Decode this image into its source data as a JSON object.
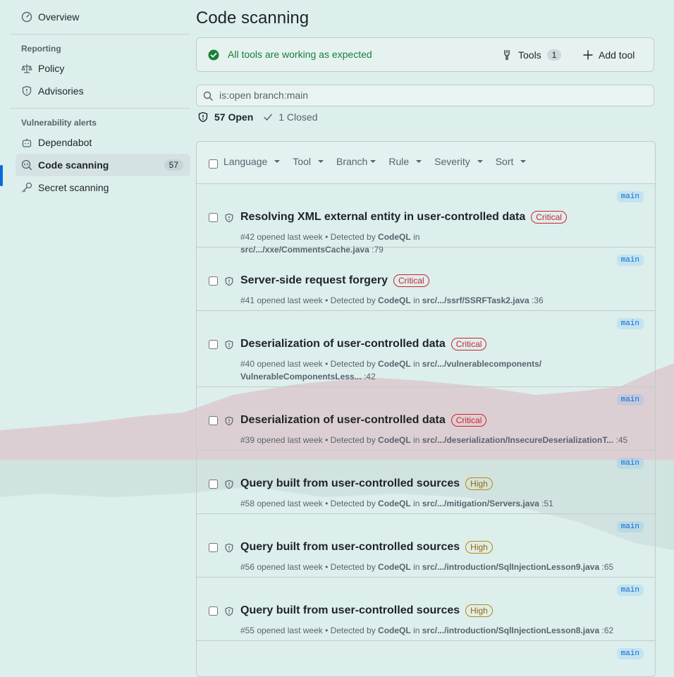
{
  "sidebar": {
    "overview": "Overview",
    "reporting_label": "Reporting",
    "policy": "Policy",
    "advisories": "Advisories",
    "vuln_label": "Vulnerability alerts",
    "dependabot": "Dependabot",
    "code_scanning": "Code scanning",
    "code_scanning_count": "57",
    "secret_scanning": "Secret scanning"
  },
  "main": {
    "title": "Code scanning",
    "status_text": "All tools are working as expected",
    "tools_label": "Tools",
    "tools_count": "1",
    "add_tool_label": "Add tool",
    "search_value": "is:open branch:main",
    "open_label": "57 Open",
    "closed_label": "1 Closed",
    "filters": [
      "Language",
      "Tool",
      "Branch",
      "Rule",
      "Severity",
      "Sort"
    ]
  },
  "alerts": [
    {
      "title": "Resolving XML external entity in user-controlled data",
      "severity": "Critical",
      "number": "#42",
      "opened": "opened last week",
      "detected": "Detected by",
      "tool": "CodeQL",
      "in": "in",
      "path": "src/.../xxe/CommentsCache.java",
      "line": ":79",
      "branch": "main"
    },
    {
      "title": "Server-side request forgery",
      "severity": "Critical",
      "number": "#41",
      "opened": "opened last week",
      "detected": "Detected by",
      "tool": "CodeQL",
      "in": "in",
      "path": "src/.../ssrf/SSRFTask2.java",
      "line": ":36",
      "branch": "main"
    },
    {
      "title": "Deserialization of user-controlled data",
      "severity": "Critical",
      "number": "#40",
      "opened": "opened last week",
      "detected": "Detected by",
      "tool": "CodeQL",
      "in": "in",
      "path": "src/.../vulnerablecomponents/ VulnerableComponentsLess...",
      "line": ":42",
      "branch": "main"
    },
    {
      "title": "Deserialization of user-controlled data",
      "severity": "Critical",
      "number": "#39",
      "opened": "opened last week",
      "detected": "Detected by",
      "tool": "CodeQL",
      "in": "in",
      "path": "src/.../deserialization/InsecureDeserializationT...",
      "line": ":45",
      "branch": "main"
    },
    {
      "title": "Query built from user-controlled sources",
      "severity": "High",
      "number": "#58",
      "opened": "opened last week",
      "detected": "Detected by",
      "tool": "CodeQL",
      "in": "in",
      "path": "src/.../mitigation/Servers.java",
      "line": ":51",
      "branch": "main"
    },
    {
      "title": "Query built from user-controlled sources",
      "severity": "High",
      "number": "#56",
      "opened": "opened last week",
      "detected": "Detected by",
      "tool": "CodeQL",
      "in": "in",
      "path": "src/.../introduction/SqlInjectionLesson9.java",
      "line": ":65",
      "branch": "main"
    },
    {
      "title": "Query built from user-controlled sources",
      "severity": "High",
      "number": "#55",
      "opened": "opened last week",
      "detected": "Detected by",
      "tool": "CodeQL",
      "in": "in",
      "path": "src/.../introduction/SqlInjectionLesson8.java",
      "line": ":62",
      "branch": "main"
    },
    {
      "title": "",
      "severity": "",
      "number": "",
      "opened": "",
      "detected": "",
      "tool": "",
      "in": "",
      "path": "",
      "line": "",
      "branch": "main"
    }
  ],
  "colors": {
    "accent": "#0969da",
    "success": "#1a7f37",
    "critical": "#cf222e",
    "high": "#9a6700"
  }
}
